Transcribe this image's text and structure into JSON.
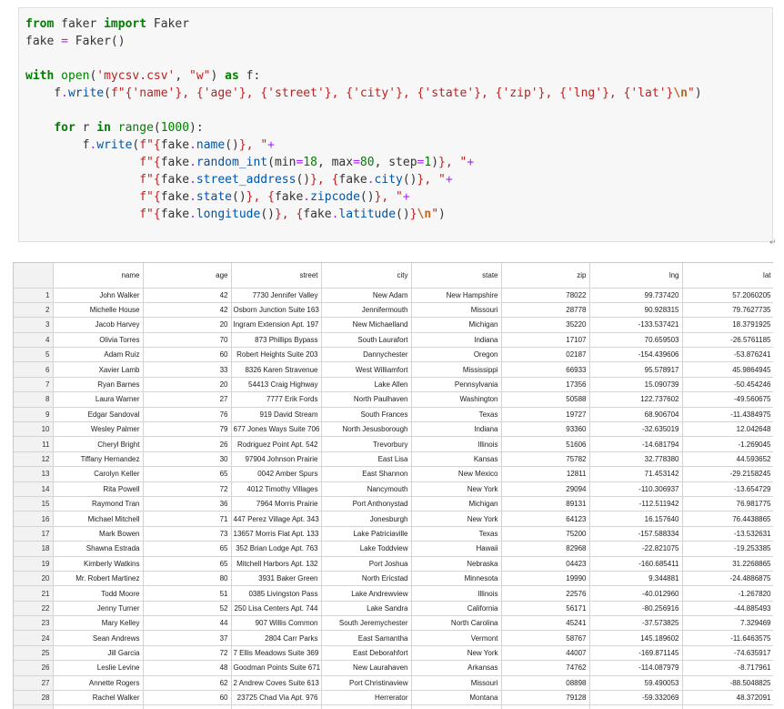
{
  "code": {
    "lines": [
      [
        [
          "k",
          "from"
        ],
        [
          "p",
          " faker "
        ],
        [
          "k",
          "import"
        ],
        [
          "p",
          " Faker"
        ]
      ],
      [
        [
          "p",
          "fake "
        ],
        [
          "o",
          "="
        ],
        [
          "p",
          " Faker()"
        ]
      ],
      [],
      [
        [
          "k",
          "with"
        ],
        [
          "p",
          " "
        ],
        [
          "n",
          "open"
        ],
        [
          "p",
          "("
        ],
        [
          "s",
          "'mycsv.csv'"
        ],
        [
          "p",
          ", "
        ],
        [
          "s",
          "\"w\""
        ],
        [
          "p",
          ") "
        ],
        [
          "k",
          "as"
        ],
        [
          "p",
          " f:"
        ]
      ],
      [
        [
          "p",
          "    f"
        ],
        [
          "o",
          "."
        ],
        [
          "f",
          "write"
        ],
        [
          "p",
          "("
        ],
        [
          "s",
          "f\"{"
        ],
        [
          "s",
          "'name'"
        ],
        [
          "s",
          "}, {"
        ],
        [
          "s",
          "'age'"
        ],
        [
          "s",
          "}, {"
        ],
        [
          "s",
          "'street'"
        ],
        [
          "s",
          "}, {"
        ],
        [
          "s",
          "'city'"
        ],
        [
          "s",
          "}, {"
        ],
        [
          "s",
          "'state'"
        ],
        [
          "s",
          "}, {"
        ],
        [
          "s",
          "'zip'"
        ],
        [
          "s",
          "}, {"
        ],
        [
          "s",
          "'lng'"
        ],
        [
          "s",
          "}, {"
        ],
        [
          "s",
          "'lat'"
        ],
        [
          "s",
          "}"
        ],
        [
          "e",
          "\\n"
        ],
        [
          "s",
          "\""
        ],
        [
          "p",
          ")"
        ]
      ],
      [],
      [
        [
          "p",
          "    "
        ],
        [
          "k",
          "for"
        ],
        [
          "p",
          " r "
        ],
        [
          "k",
          "in"
        ],
        [
          "p",
          " "
        ],
        [
          "n",
          "range"
        ],
        [
          "p",
          "("
        ],
        [
          "num",
          "1000"
        ],
        [
          "p",
          "):"
        ]
      ],
      [
        [
          "p",
          "        f"
        ],
        [
          "o",
          "."
        ],
        [
          "f",
          "write"
        ],
        [
          "p",
          "("
        ],
        [
          "s",
          "f\"{"
        ],
        [
          "p",
          "fake"
        ],
        [
          "o",
          "."
        ],
        [
          "f",
          "name"
        ],
        [
          "p",
          "()"
        ],
        [
          "s",
          "}, \""
        ],
        [
          "o",
          "+"
        ]
      ],
      [
        [
          "p",
          "                "
        ],
        [
          "s",
          "f\"{"
        ],
        [
          "p",
          "fake"
        ],
        [
          "o",
          "."
        ],
        [
          "f",
          "random_int"
        ],
        [
          "p",
          "(min"
        ],
        [
          "o",
          "="
        ],
        [
          "num",
          "18"
        ],
        [
          "p",
          ", max"
        ],
        [
          "o",
          "="
        ],
        [
          "num",
          "80"
        ],
        [
          "p",
          ", step"
        ],
        [
          "o",
          "="
        ],
        [
          "num",
          "1"
        ],
        [
          "p",
          ")"
        ],
        [
          "s",
          "}, \""
        ],
        [
          "o",
          "+"
        ]
      ],
      [
        [
          "p",
          "                "
        ],
        [
          "s",
          "f\"{"
        ],
        [
          "p",
          "fake"
        ],
        [
          "o",
          "."
        ],
        [
          "f",
          "street_address"
        ],
        [
          "p",
          "()"
        ],
        [
          "s",
          "}, {"
        ],
        [
          "p",
          "fake"
        ],
        [
          "o",
          "."
        ],
        [
          "f",
          "city"
        ],
        [
          "p",
          "()"
        ],
        [
          "s",
          "}, \""
        ],
        [
          "o",
          "+"
        ]
      ],
      [
        [
          "p",
          "                "
        ],
        [
          "s",
          "f\"{"
        ],
        [
          "p",
          "fake"
        ],
        [
          "o",
          "."
        ],
        [
          "f",
          "state"
        ],
        [
          "p",
          "()"
        ],
        [
          "s",
          "}, {"
        ],
        [
          "p",
          "fake"
        ],
        [
          "o",
          "."
        ],
        [
          "f",
          "zipcode"
        ],
        [
          "p",
          "()"
        ],
        [
          "s",
          "}, \""
        ],
        [
          "o",
          "+"
        ]
      ],
      [
        [
          "p",
          "                "
        ],
        [
          "s",
          "f\"{"
        ],
        [
          "p",
          "fake"
        ],
        [
          "o",
          "."
        ],
        [
          "f",
          "longitude"
        ],
        [
          "p",
          "()"
        ],
        [
          "s",
          "}, {"
        ],
        [
          "p",
          "fake"
        ],
        [
          "o",
          "."
        ],
        [
          "f",
          "latitude"
        ],
        [
          "p",
          "()"
        ],
        [
          "s",
          "}"
        ],
        [
          "e",
          "\\n"
        ],
        [
          "s",
          "\""
        ],
        [
          "p",
          ")"
        ]
      ]
    ]
  },
  "return_mark": "↵",
  "table": {
    "columns": [
      "",
      "name",
      "age",
      "street",
      "city",
      "state",
      "zip",
      "lng",
      "lat"
    ],
    "rows": [
      [
        "1",
        "John Walker",
        "42",
        "7730 Jennifer Valley",
        "New Adam",
        "New Hampshire",
        "78022",
        "99.737420",
        "57.2060205"
      ],
      [
        "2",
        "Michelle House",
        "42",
        "Osborn Junction Suite 163",
        "Jennifermouth",
        "Missouri",
        "28778",
        "90.928315",
        "79.7627735"
      ],
      [
        "3",
        "Jacob Harvey",
        "20",
        "Ingram Extension Apt. 197",
        "New Michaelland",
        "Michigan",
        "35220",
        "-133.537421",
        "18.3791925"
      ],
      [
        "4",
        "Olivia Torres",
        "70",
        "873 Phillips Bypass",
        "South Laurafort",
        "Indiana",
        "17107",
        "70.659503",
        "-26.5761185"
      ],
      [
        "5",
        "Adam Ruiz",
        "60",
        "Robert Heights Suite 203",
        "Dannychester",
        "Oregon",
        "02187",
        "-154.439606",
        "-53.876241"
      ],
      [
        "6",
        "Xavier Lamb",
        "33",
        "8326 Karen Stravenue",
        "West Williamfort",
        "Mississippi",
        "66933",
        "95.578917",
        "45.9864945"
      ],
      [
        "7",
        "Ryan Barnes",
        "20",
        "54413 Craig Highway",
        "Lake Allen",
        "Pennsylvania",
        "17356",
        "15.090739",
        "-50.454246"
      ],
      [
        "8",
        "Laura Warner",
        "27",
        "7777 Erik Fords",
        "North Paulhaven",
        "Washington",
        "50588",
        "122.737602",
        "-49.560675"
      ],
      [
        "9",
        "Edgar Sandoval",
        "76",
        "919 David Stream",
        "South Frances",
        "Texas",
        "19727",
        "68.906704",
        "-11.4384975"
      ],
      [
        "10",
        "Wesley Palmer",
        "79",
        "677 Jones Ways Suite 706",
        "North Jesusborough",
        "Indiana",
        "93360",
        "-32.635019",
        "12.042648"
      ],
      [
        "11",
        "Cheryl Bright",
        "26",
        "Rodriguez Point Apt. 542",
        "Trevorbury",
        "Illinois",
        "51606",
        "-14.681794",
        "-1.269045"
      ],
      [
        "12",
        "Tiffany Hernandez",
        "30",
        "97904 Johnson Prairie",
        "East Lisa",
        "Kansas",
        "75782",
        "32.778380",
        "44.593652"
      ],
      [
        "13",
        "Carolyn Keller",
        "65",
        "0042 Amber Spurs",
        "East Shannon",
        "New Mexico",
        "12811",
        "71.453142",
        "-29.2158245"
      ],
      [
        "14",
        "Rita Powell",
        "72",
        "4012 Timothy Villages",
        "Nancymouth",
        "New York",
        "29094",
        "-110.306937",
        "-13.654729"
      ],
      [
        "15",
        "Raymond Tran",
        "36",
        "7964 Morris Prairie",
        "Port Anthonystad",
        "Michigan",
        "89131",
        "-112.511942",
        "76.981775"
      ],
      [
        "16",
        "Michael Mitchell",
        "71",
        "447 Perez Village Apt. 343",
        "Jonesburgh",
        "New York",
        "64123",
        "16.157640",
        "76.4438865"
      ],
      [
        "17",
        "Mark Bowen",
        "73",
        "13657 Morris Flat Apt. 133",
        "Lake Patriciaville",
        "Texas",
        "75200",
        "-157.588334",
        "-13.532631"
      ],
      [
        "18",
        "Shawna Estrada",
        "65",
        "352 Brian Lodge Apt. 763",
        "Lake Toddview",
        "Hawaii",
        "82968",
        "-22.821075",
        "-19.253385"
      ],
      [
        "19",
        "Kimberly Watkins",
        "65",
        "Mitchell Harbors Apt. 132",
        "Port Joshua",
        "Nebraska",
        "04423",
        "-160.685411",
        "31.2268865"
      ],
      [
        "20",
        "Mr. Robert Martinez",
        "80",
        "3931 Baker Green",
        "North Ericstad",
        "Minnesota",
        "19990",
        "9.344881",
        "-24.4886875"
      ],
      [
        "21",
        "Todd Moore",
        "51",
        "0385 Livingston Pass",
        "Lake Andrewview",
        "Illinois",
        "22576",
        "-40.012960",
        "-1.267820"
      ],
      [
        "22",
        "Jenny Turner",
        "52",
        "250 Lisa Centers Apt. 744",
        "Lake Sandra",
        "California",
        "56171",
        "-80.256916",
        "-44.885493"
      ],
      [
        "23",
        "Mary Kelley",
        "44",
        "907 Willis Common",
        "South Jeremychester",
        "North Carolina",
        "45241",
        "-37.573825",
        "7.329469"
      ],
      [
        "24",
        "Sean Andrews",
        "37",
        "2804 Carr Parks",
        "East Samantha",
        "Vermont",
        "58767",
        "145.189602",
        "-11.6463575"
      ],
      [
        "25",
        "Jill Garcia",
        "72",
        "7 Ellis Meadows Suite 369",
        "East Deborahfort",
        "New York",
        "44007",
        "-169.871145",
        "-74.635917"
      ],
      [
        "26",
        "Leslie Levine",
        "48",
        "Goodman Points Suite 671",
        "New Laurahaven",
        "Arkansas",
        "74762",
        "-114.087979",
        "-8.717961"
      ],
      [
        "27",
        "Annette Rogers",
        "62",
        "2 Andrew Coves Suite 613",
        "Port Christinaview",
        "Missouri",
        "08898",
        "59.490053",
        "-88.5048825"
      ],
      [
        "28",
        "Rachel Walker",
        "60",
        "23725 Chad Via Apt. 976",
        "Herrerator",
        "Montana",
        "79128",
        "-59.332069",
        "48.372091"
      ],
      [
        "29",
        "",
        "",
        "",
        "",
        "",
        "",
        "",
        ""
      ]
    ]
  }
}
